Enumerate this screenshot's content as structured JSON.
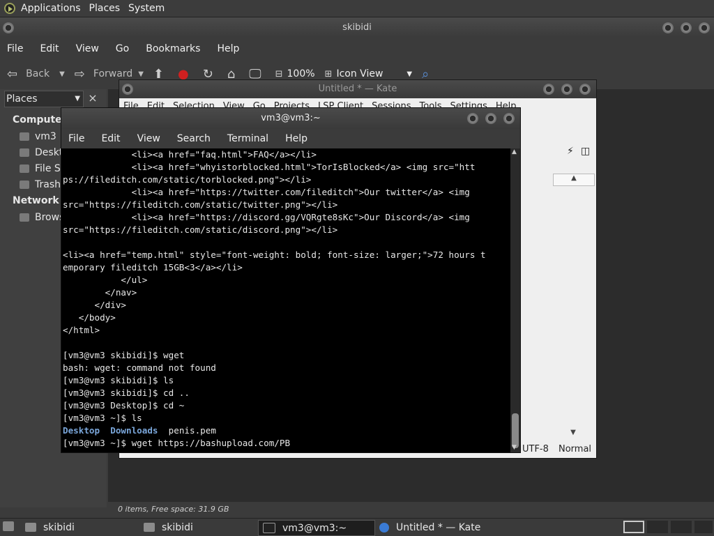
{
  "top_panel": {
    "items": [
      "Applications",
      "Places",
      "System"
    ]
  },
  "file_manager": {
    "title": "skibidi",
    "menu": [
      "File",
      "Edit",
      "View",
      "Go",
      "Bookmarks",
      "Help"
    ],
    "toolbar": {
      "back": "Back",
      "forward": "Forward",
      "zoom": "100%",
      "view_mode": "Icon View"
    },
    "sidebar": {
      "selector": "Places",
      "close": "×",
      "computer_label": "Computer",
      "computer_items": [
        "vm3",
        "Deskt",
        "File Sy",
        "Trash"
      ],
      "network_label": "Network",
      "network_items": [
        "Brows"
      ]
    },
    "status": "0 items, Free space: 31.9 GB"
  },
  "kate": {
    "title": "Untitled * — Kate",
    "menu": [
      "File",
      "Edit",
      "Selection",
      "View",
      "Go",
      "Projects",
      "LSP Client",
      "Sessions",
      "Tools",
      "Settings",
      "Help"
    ],
    "encoding": "UTF-8",
    "mode": "Normal"
  },
  "terminal": {
    "title": "vm3@vm3:~",
    "menu": [
      "File",
      "Edit",
      "View",
      "Search",
      "Terminal",
      "Help"
    ],
    "lines": [
      "             <li><a href=\"faq.html\">FAQ</a></li>",
      "             <li><a href=\"whyistorblocked.html\">TorIsBlocked</a> <img src=\"htt",
      "ps://fileditch.com/static/torblocked.png\"></li>",
      "             <li><a href=\"https://twitter.com/fileditch\">Our twitter</a> <img",
      "src=\"https://fileditch.com/static/twitter.png\"></li>",
      "             <li><a href=\"https://discord.gg/VQRgte8sKc\">Our Discord</a> <img",
      "src=\"https://fileditch.com/static/discord.png\"></li>",
      "",
      "<li><a href=\"temp.html\" style=\"font-weight: bold; font-size: larger;\">72 hours t",
      "emporary fileditch 15GB<3</a></li>",
      "           </ul>",
      "        </nav>",
      "      </div>",
      "   </body>",
      "</html>",
      "",
      "[vm3@vm3 skibidi]$ wget",
      "bash: wget: command not found",
      "[vm3@vm3 skibidi]$ ls",
      "[vm3@vm3 skibidi]$ cd ..",
      "[vm3@vm3 Desktop]$ cd ~",
      "[vm3@vm3 ~]$ ls"
    ],
    "ls_output": {
      "dir1": "Desktop",
      "dir2": "Downloads",
      "file1": "penis.pem"
    },
    "last_line": "[vm3@vm3 ~]$ wget https://bashupload.com/PB"
  },
  "taskbar": {
    "tasks": [
      "skibidi",
      "skibidi",
      "vm3@vm3:~",
      "Untitled * — Kate"
    ]
  }
}
